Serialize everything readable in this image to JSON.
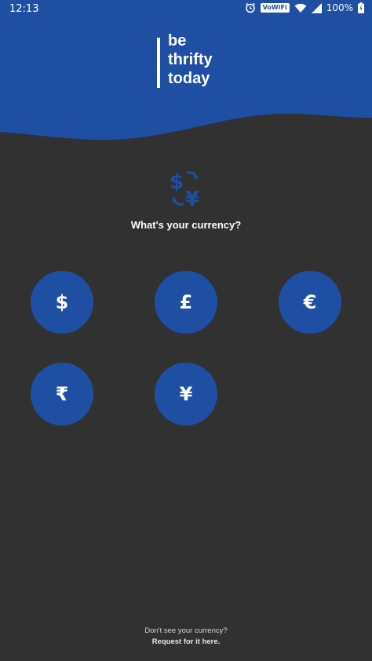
{
  "colors": {
    "brand_blue": "#1e4fa3",
    "background": "#313131",
    "text": "#ffffff"
  },
  "status_bar": {
    "time": "12:13",
    "wifi_label": "VoWiFi",
    "battery": "100%",
    "icons": [
      "alarm-icon",
      "wifi-icon",
      "signal-icon",
      "battery-icon"
    ]
  },
  "logo": {
    "line1": "be",
    "line2": "thrifty",
    "line3": "today"
  },
  "prompt": {
    "icon": "currency-exchange-icon",
    "question": "What's your currency?"
  },
  "currencies": [
    {
      "symbol": "$"
    },
    {
      "symbol": "£"
    },
    {
      "symbol": "€"
    },
    {
      "symbol": "₹"
    },
    {
      "symbol": "¥"
    }
  ],
  "footer": {
    "line1": "Don't see your currency?",
    "link": "Request for it here."
  }
}
